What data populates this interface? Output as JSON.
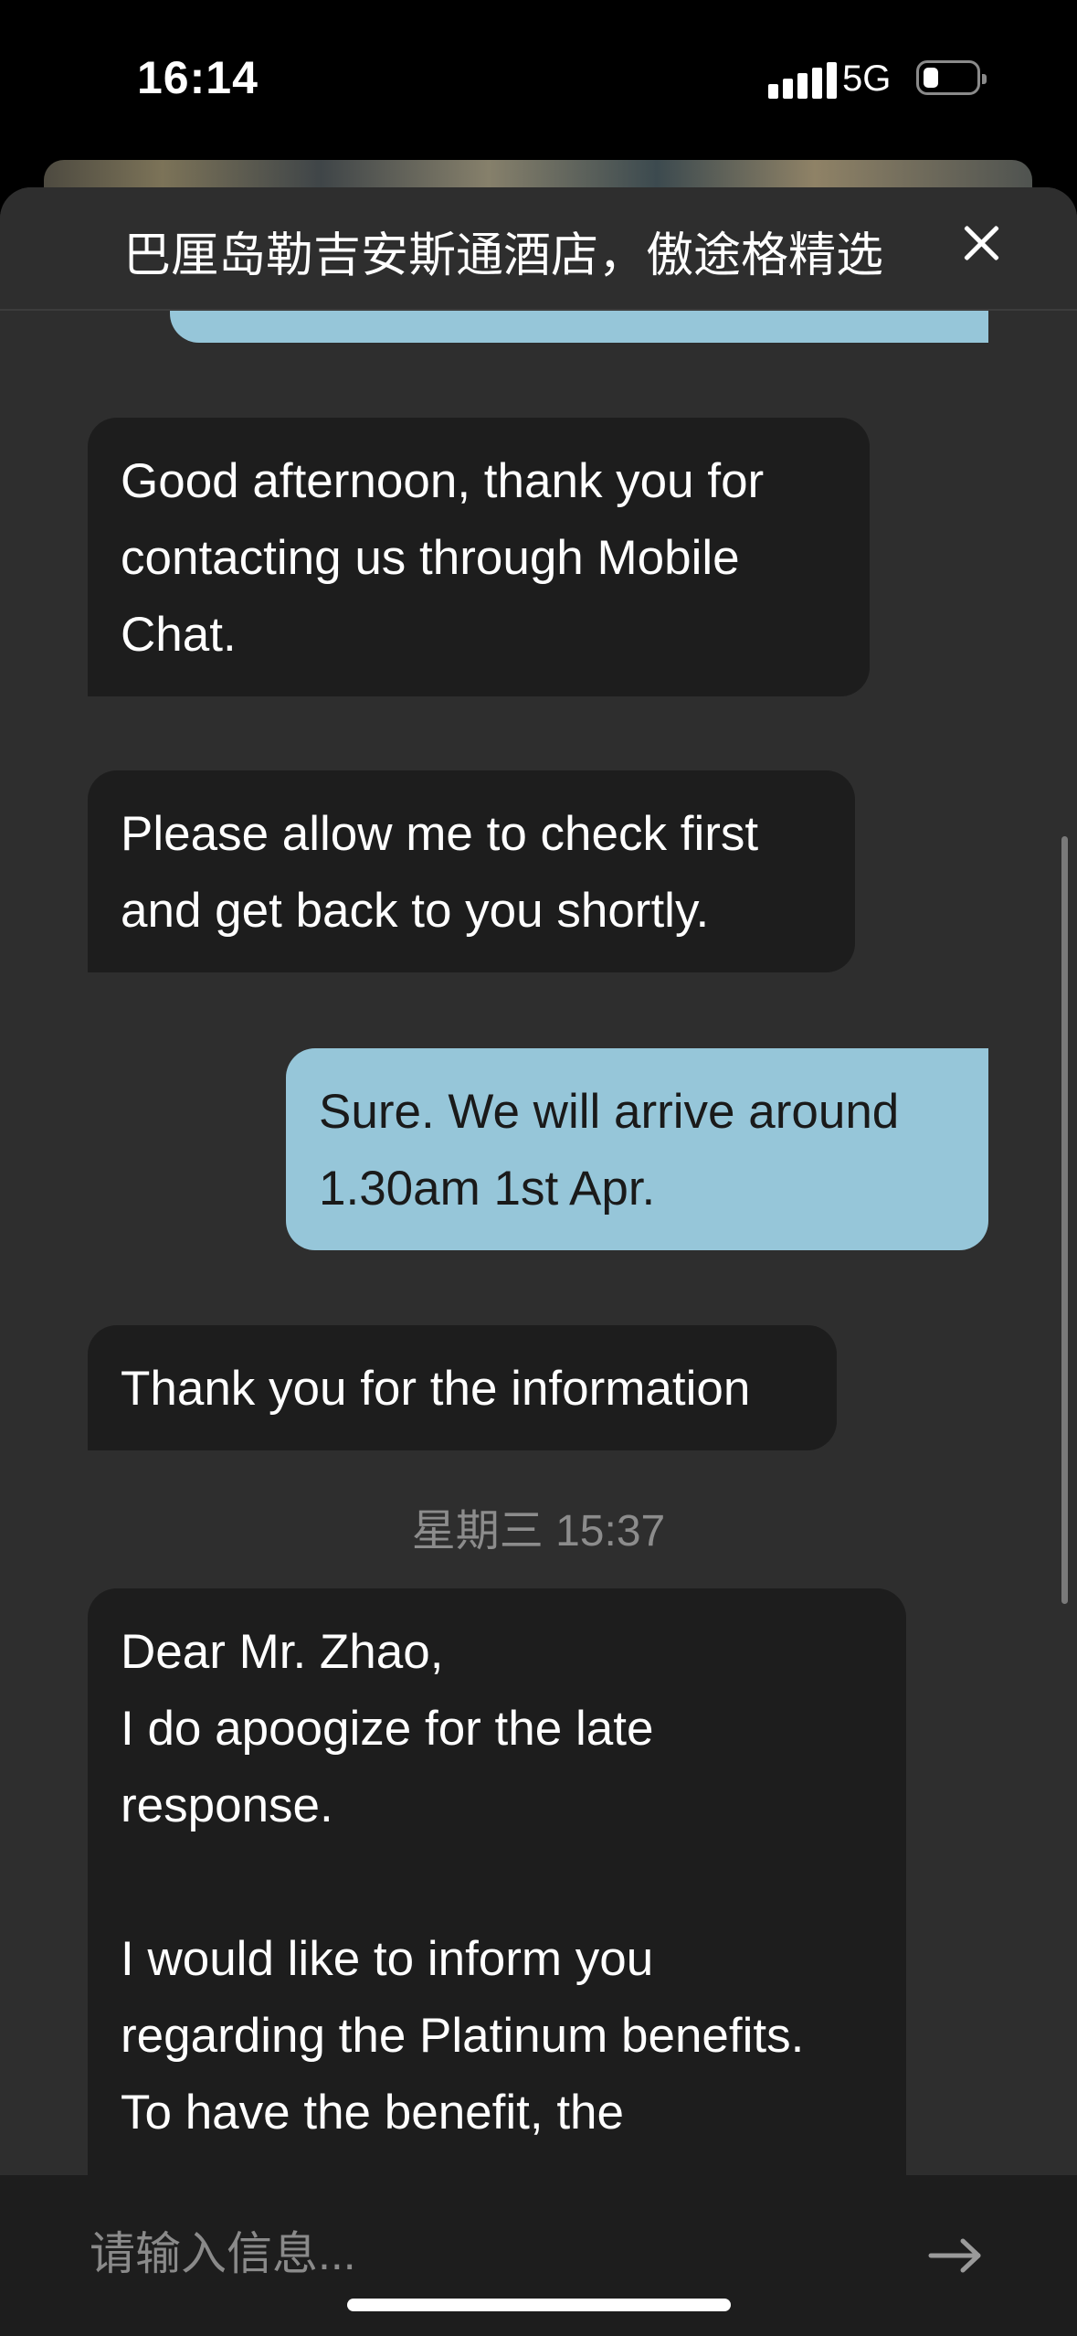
{
  "status_bar": {
    "time": "16:14",
    "network": "5G",
    "battery_level": 0.2
  },
  "header": {
    "title": "巴厘岛勒吉安斯通酒店，傲途格精选"
  },
  "messages": [
    {
      "sender": "hotel",
      "text": "Good afternoon, thank you for\ncontacting us through Mobile\nChat."
    },
    {
      "sender": "hotel",
      "text": "Please allow me to check first\nand get back to you shortly."
    },
    {
      "sender": "user",
      "text": "Sure. We will arrive around\n1.30am 1st Apr."
    },
    {
      "sender": "hotel",
      "text": "Thank you for the information"
    },
    {
      "sender": "hotel",
      "text": "Dear Mr. Zhao,\nI do apoogize for the late\nresponse.\n\nI would like to inform you\nregarding the Platinum benefits.\nTo have the benefit, the"
    }
  ],
  "timestamp": "星期三 15:37",
  "composer": {
    "placeholder": "请输入信息..."
  },
  "colors": {
    "user_bubble": "#96c6d9",
    "hotel_bubble": "#1d1d1d",
    "background": "#2e2e2e"
  }
}
